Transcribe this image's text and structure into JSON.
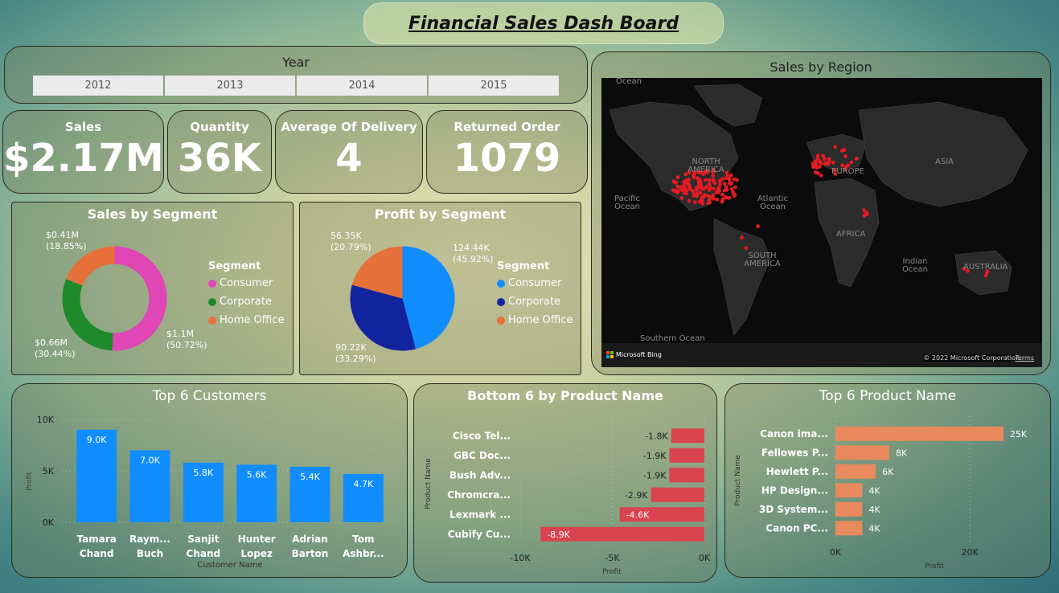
{
  "header": {
    "title": "Financial Sales Dash Board"
  },
  "year_slicer": {
    "label": "Year",
    "options": [
      "2012",
      "2013",
      "2014",
      "2015"
    ]
  },
  "kpis": {
    "sales": {
      "label": "Sales",
      "value": "$2.17M"
    },
    "quantity": {
      "label": "Quantity",
      "value": "36K"
    },
    "avg_delivery": {
      "label": "Average Of Delivery",
      "value": "4"
    },
    "returned": {
      "label": "Returned Order",
      "value": "1079"
    }
  },
  "sales_by_segment": {
    "title": "Sales by Segment",
    "legend_title": "Segment",
    "chart_data": {
      "type": "pie",
      "style": "donut",
      "slices": [
        {
          "name": "Consumer",
          "value": 1.1,
          "label": "$1.1M",
          "pct": "(50.72%)",
          "color": "#e046b5"
        },
        {
          "name": "Corporate",
          "value": 0.66,
          "label": "$0.66M",
          "pct": "(30.44%)",
          "color": "#1f8a2a"
        },
        {
          "name": "Home Office",
          "value": 0.41,
          "label": "$0.41M",
          "pct": "(18.85%)",
          "color": "#e8703a"
        }
      ]
    }
  },
  "profit_by_segment": {
    "title": "Profit by Segment",
    "legend_title": "Segment",
    "chart_data": {
      "type": "pie",
      "slices": [
        {
          "name": "Consumer",
          "value": 124.44,
          "label": "124.44K",
          "pct": "(45.92%)",
          "color": "#118dff"
        },
        {
          "name": "Corporate",
          "value": 90.22,
          "label": "90.22K",
          "pct": "(33.29%)",
          "color": "#12239e"
        },
        {
          "name": "Home Office",
          "value": 56.35,
          "label": "56.35K",
          "pct": "(20.79%)",
          "color": "#e8703a"
        }
      ]
    }
  },
  "sales_by_region": {
    "title": "Sales by Region",
    "map_labels": {
      "ocean_top": "Ocean",
      "north_america": "NORTH AMERICA",
      "europe": "EUROPE",
      "asia": "ASIA",
      "pacific": "Pacific Ocean",
      "atlantic": "Atlantic Ocean",
      "africa": "AFRICA",
      "south_america": "SOUTH AMERICA",
      "indian": "Indian Ocean",
      "australia": "AUSTRALIA",
      "southern": "Southern Ocean"
    },
    "bing_logo": "Microsoft Bing",
    "copyright": "© 2022 Microsoft Corporation",
    "terms": "Terms"
  },
  "top_customers": {
    "title": "Top 6 Customers",
    "chart_data": {
      "type": "bar",
      "categories": [
        "Tamara Chand",
        "Raym... Buch",
        "Sanjit Chand",
        "Hunter Lopez",
        "Adrian Barton",
        "Tom Ashbr..."
      ],
      "values": [
        9.0,
        7.0,
        5.8,
        5.6,
        5.4,
        4.7
      ],
      "value_labels": [
        "9.0K",
        "7.0K",
        "5.8K",
        "5.6K",
        "5.4K",
        "4.7K"
      ],
      "xlabel": "Customer Name",
      "ylabel": "Profit",
      "y_ticks": [
        "0K",
        "5K",
        "10K"
      ],
      "ylim": [
        0,
        10
      ],
      "color": "#118dff"
    }
  },
  "bottom_products": {
    "title": "Bottom 6 by Product Name",
    "chart_data": {
      "type": "bar",
      "orientation": "horizontal",
      "categories": [
        "Cisco Tel...",
        "GBC Doc...",
        "Bush Adv...",
        "Chromcra...",
        "Lexmark ...",
        "Cubify Cu..."
      ],
      "values": [
        -1.8,
        -1.9,
        -1.9,
        -2.9,
        -4.6,
        -8.9
      ],
      "value_labels": [
        "-1.8K",
        "-1.9K",
        "-1.9K",
        "-2.9K",
        "-4.6K",
        "-8.9K"
      ],
      "xlabel": "Profit",
      "ylabel": "Product Name",
      "x_ticks": [
        "-10K",
        "-5K",
        "0K"
      ],
      "xlim": [
        -10,
        0
      ],
      "color": "#d9434f"
    }
  },
  "top_products": {
    "title": "Top 6 Product Name",
    "chart_data": {
      "type": "bar",
      "orientation": "horizontal",
      "categories": [
        "Canon ima...",
        "Fellowes P...",
        "Hewlett P...",
        "HP Design...",
        "3D System...",
        "Canon PC..."
      ],
      "values": [
        25,
        8,
        6,
        4,
        4,
        4
      ],
      "value_labels": [
        "25K",
        "8K",
        "6K",
        "4K",
        "4K",
        "4K"
      ],
      "xlabel": "Profit",
      "ylabel": "Product Name",
      "x_ticks": [
        "0K",
        "20K"
      ],
      "xlim": [
        0,
        28
      ],
      "color": "#e88a5e"
    }
  }
}
